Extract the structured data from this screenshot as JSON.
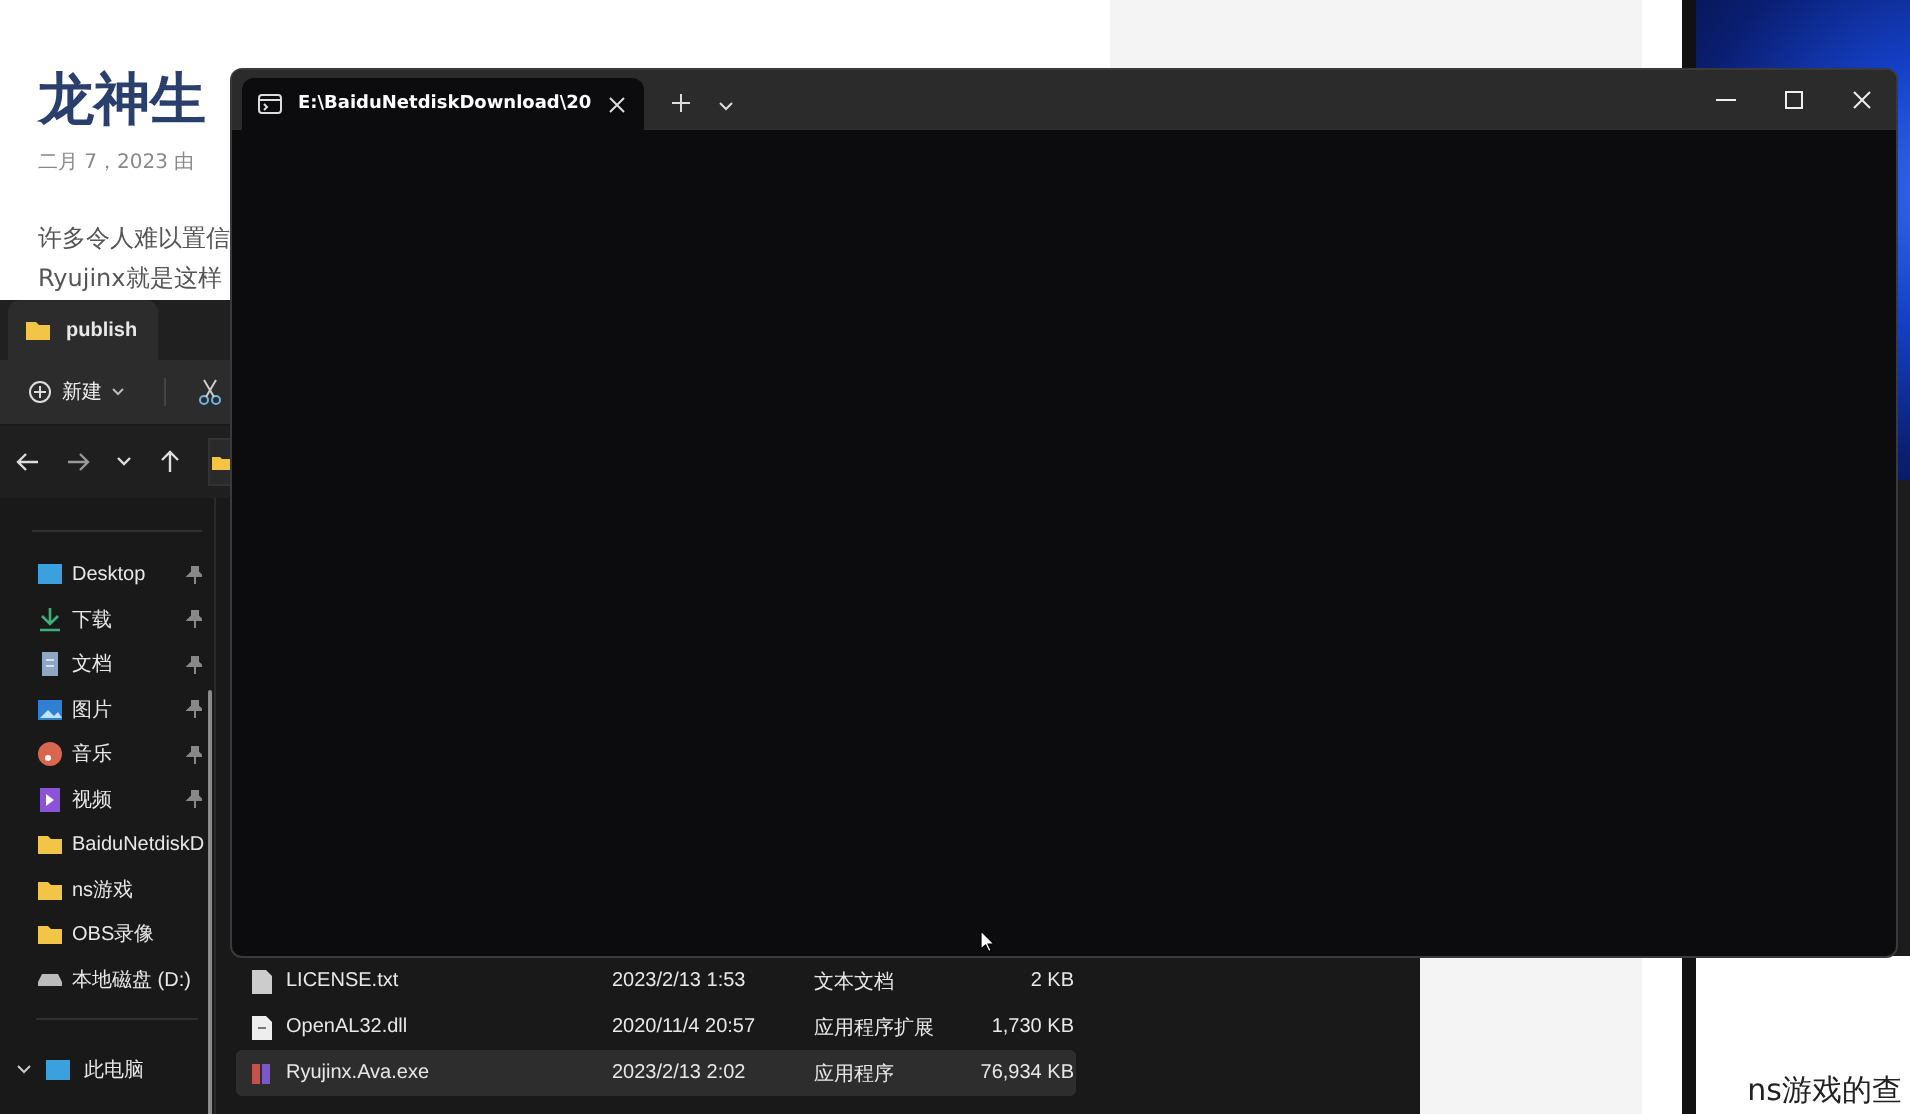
{
  "article": {
    "title": "龙神生",
    "meta": "二月 7，2023 由",
    "lines": [
      "许多令人难以置信",
      "Ryujinx就是这样"
    ]
  },
  "explorer": {
    "title": "publish",
    "new_label": "新建",
    "quick_access": [
      {
        "label": "Desktop",
        "kind": "desktop",
        "pinned": true
      },
      {
        "label": "下载",
        "kind": "download",
        "pinned": true
      },
      {
        "label": "文档",
        "kind": "document",
        "pinned": true
      },
      {
        "label": "图片",
        "kind": "picture",
        "pinned": true
      },
      {
        "label": "音乐",
        "kind": "music",
        "pinned": true
      },
      {
        "label": "视频",
        "kind": "video",
        "pinned": true
      },
      {
        "label": "BaiduNetdiskD",
        "kind": "folder",
        "pinned": false
      },
      {
        "label": "ns游戏",
        "kind": "folder",
        "pinned": false
      },
      {
        "label": "OBS录像",
        "kind": "folder",
        "pinned": false
      },
      {
        "label": "本地磁盘 (D:)",
        "kind": "drive",
        "pinned": false
      }
    ],
    "this_pc": {
      "label": "此电脑",
      "expanded": true
    },
    "files": [
      {
        "name": "LICENSE.txt",
        "kind": "text",
        "modified": "2023/2/13 1:53",
        "type": "文本文档",
        "size": "2 KB",
        "selected": false
      },
      {
        "name": "OpenAL32.dll",
        "kind": "dll",
        "modified": "2020/11/4 20:57",
        "type": "应用程序扩展",
        "size": "1,730 KB",
        "selected": false
      },
      {
        "name": "Ryujinx.Ava.exe",
        "kind": "exe",
        "modified": "2023/2/13 2:02",
        "type": "应用程序",
        "size": "76,934 KB",
        "selected": true
      }
    ]
  },
  "terminal": {
    "tabs": [
      {
        "title": "E:\\BaiduNetdiskDownload\\20",
        "selected": true
      }
    ]
  },
  "desktop_text": "ns游戏的查"
}
